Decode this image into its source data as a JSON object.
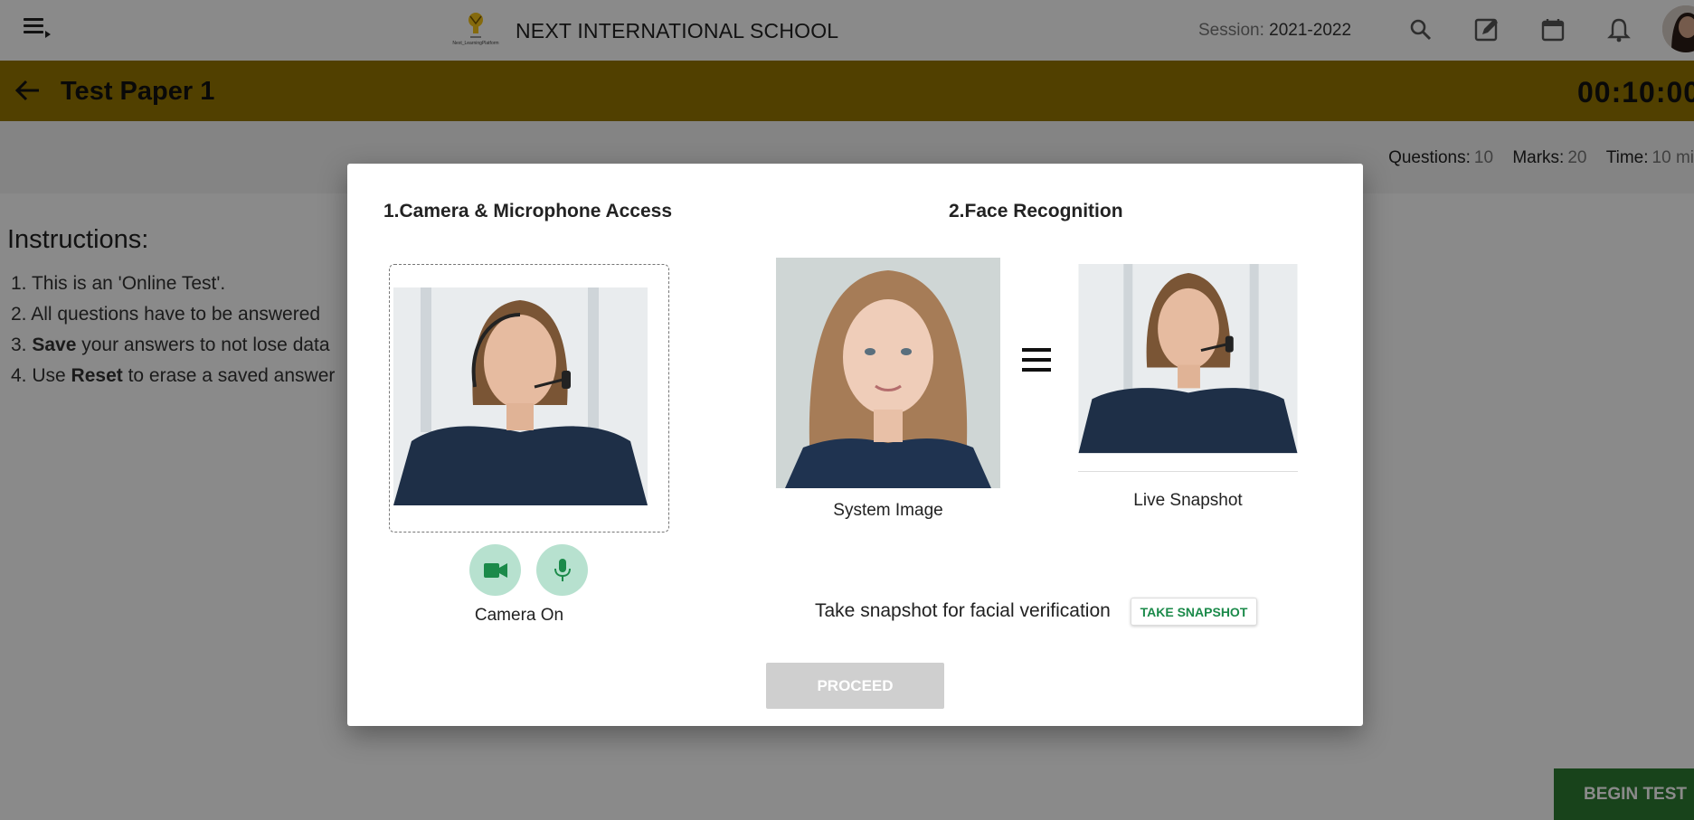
{
  "header": {
    "school_name": "NEXT INTERNATIONAL SCHOOL",
    "logo_caption": "Next_LearningPlatform",
    "session_label": "Session:",
    "session_value": "2021-2022",
    "icons": [
      "menu-icon",
      "search-icon",
      "edit-note-icon",
      "calendar-icon",
      "bell-icon",
      "avatar"
    ]
  },
  "titlebar": {
    "title": "Test Paper 1",
    "timer": "00:10:00",
    "color": "#977600"
  },
  "test_info": {
    "questions_label": "Questions:",
    "questions_value": "10",
    "marks_label": "Marks:",
    "marks_value": "20",
    "time_label": "Time:",
    "time_value": "10 mi"
  },
  "instructions": {
    "title": "Instructions:",
    "items": [
      {
        "num": "1.",
        "pre": "This is an 'Online Test'.",
        "bold": "",
        "post": ""
      },
      {
        "num": "2.",
        "pre": "All questions have to be answered",
        "bold": "",
        "post": ""
      },
      {
        "num": "3.",
        "pre": "",
        "bold": "Save",
        "post": " your answers to not lose data"
      },
      {
        "num": "4.",
        "pre": "Use ",
        "bold": "Reset",
        "post": " to erase a saved answer"
      }
    ]
  },
  "begin_button": "BEGIN TEST",
  "modal": {
    "section1_title": "1.Camera & Microphone Access",
    "section2_title": "2.Face Recognition",
    "camera_caption": "Camera On",
    "system_image_caption": "System Image",
    "live_snapshot_caption": "Live Snapshot",
    "snapshot_prompt": "Take snapshot for facial verification",
    "snapshot_button": "TAKE SNAPSHOT",
    "proceed_button": "PROCEED",
    "accent_color": "#1b8a4a"
  }
}
